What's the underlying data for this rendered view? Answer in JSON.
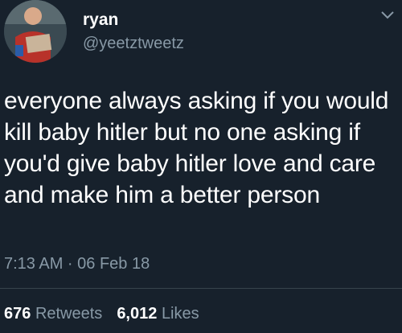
{
  "author": {
    "name": "ryan",
    "handle": "@yeetztweetz",
    "avatar_icon": "profile-photo-icon"
  },
  "tweet": {
    "text": "everyone always asking if you would kill baby hitler but no one asking if you'd give baby hitler love and care and make him a better person",
    "timestamp": "7:13 AM · 06 Feb 18"
  },
  "stats": {
    "retweets_count": "676",
    "retweets_label": "Retweets",
    "likes_count": "6,012",
    "likes_label": "Likes"
  },
  "menu": {
    "caret_icon": "chevron-down-icon"
  },
  "colors": {
    "background": "#17212c",
    "text": "#ffffff",
    "secondary": "#8899a6",
    "divider": "#38444d"
  }
}
